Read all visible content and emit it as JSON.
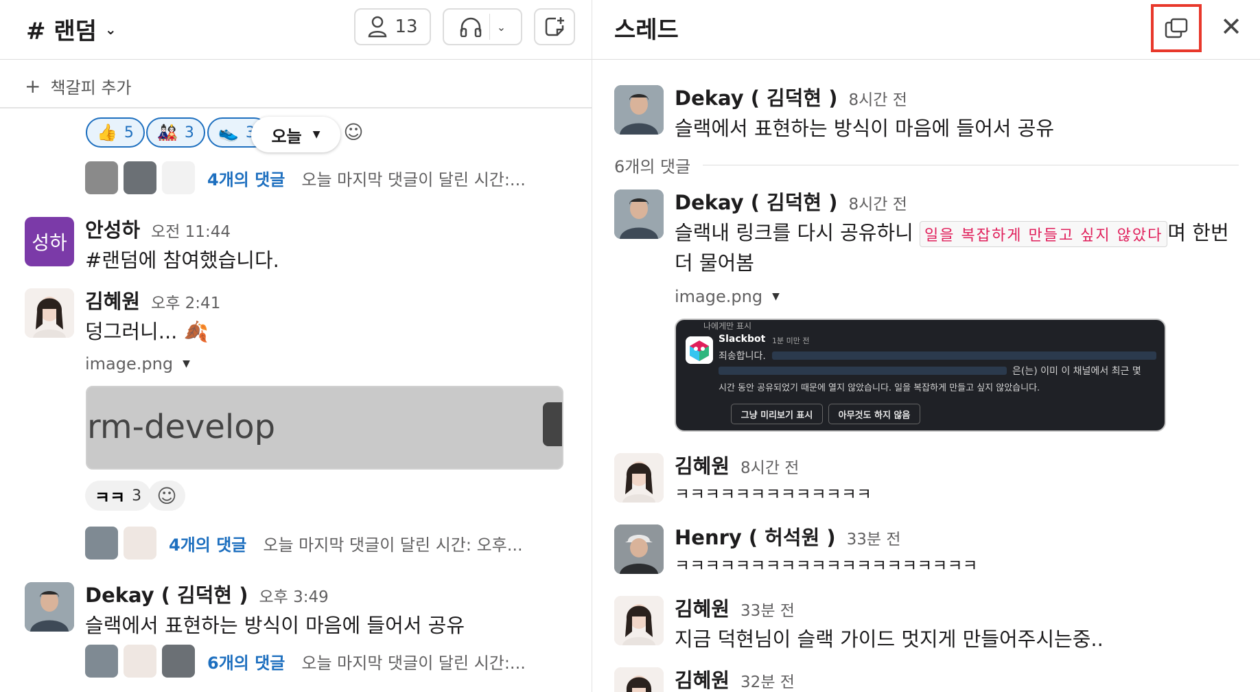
{
  "channel": {
    "title": "# 랜덤",
    "member_count": "13"
  },
  "bookmark": {
    "add_label": "책갈피 추가"
  },
  "reactions_top": [
    {
      "emoji": "👍",
      "count": "5"
    },
    {
      "emoji": "🎎",
      "count": "3"
    },
    {
      "emoji": "👟",
      "count": "3"
    }
  ],
  "date_pill": "오늘",
  "thread_summary_1": {
    "count": "4개의 댓글",
    "meta": "오늘 마지막 댓글이 달린 시간:..."
  },
  "messages": [
    {
      "author": "안성하",
      "avatar_text": "성하",
      "time": "오전 11:44",
      "text": "#랜덤에 참여했습니다."
    },
    {
      "author": "김혜원",
      "time": "오후 2:41",
      "text": "덩그러니...",
      "emoji": "🍂",
      "file_name": "image.png",
      "image_text": "rm-develop"
    },
    {
      "author": "Dekay ( 김덕현 )",
      "time": "오후 3:49",
      "text": "슬랙에서 표현하는 방식이 마음에 들어서 공유"
    }
  ],
  "reactions_mid": [
    {
      "emoji": "ㅋㅋ",
      "count": "3"
    }
  ],
  "thread_summary_2": {
    "count": "4개의 댓글",
    "meta": "오늘 마지막 댓글이 달린 시간: 오후..."
  },
  "thread_summary_3": {
    "count": "6개의 댓글",
    "meta": "오늘 마지막 댓글이 달린 시간:..."
  },
  "thread": {
    "title": "스레드",
    "parent": {
      "author": "Dekay ( 김덕현 )",
      "time": "8시간 전",
      "text": "슬랙에서 표현하는 방식이 마음에 들어서 공유"
    },
    "reply_count": "6개의 댓글",
    "replies": [
      {
        "author": "Dekay ( 김덕현 )",
        "time": "8시간 전",
        "text_before": "슬랙내 링크를 다시 공유하니",
        "highlight": "일을 복잡하게 만들고 싶지 않았다",
        "text_after": "며 한번",
        "text_line2": "더 물어봄",
        "file_name": "image.png"
      },
      {
        "author": "김혜원",
        "time": "8시간 전",
        "text": "ㅋㅋㅋㅋㅋㅋㅋㅋㅋㅋㅋㅋㅋ"
      },
      {
        "author": "Henry ( 허석원 )",
        "time": "33분 전",
        "text": "ㅋㅋㅋㅋㅋㅋㅋㅋㅋㅋㅋㅋㅋㅋㅋㅋㅋㅋㅋㅋ"
      },
      {
        "author": "김혜원",
        "time": "33분 전",
        "text": "지금 덕현님이 슬랙 가이드 멋지게 만들어주시는중.."
      },
      {
        "author": "김혜원",
        "time": "32분 전"
      }
    ]
  },
  "slackbot_image": {
    "visibility": "나에게만 표시",
    "bot_name": "Slackbot",
    "bot_time": "1분 미만 전",
    "line1": "죄송합니다.",
    "line2_tail": "은(는) 이미 이 채널에서 최근 몇",
    "line3": "시간 동안 공유되었기 때문에 열지 않았습니다. 일을 복잡하게 만들고 싶지 않았습니다.",
    "btn1": "그냥 미리보기 표시",
    "btn2": "아무것도 하지 않음"
  }
}
